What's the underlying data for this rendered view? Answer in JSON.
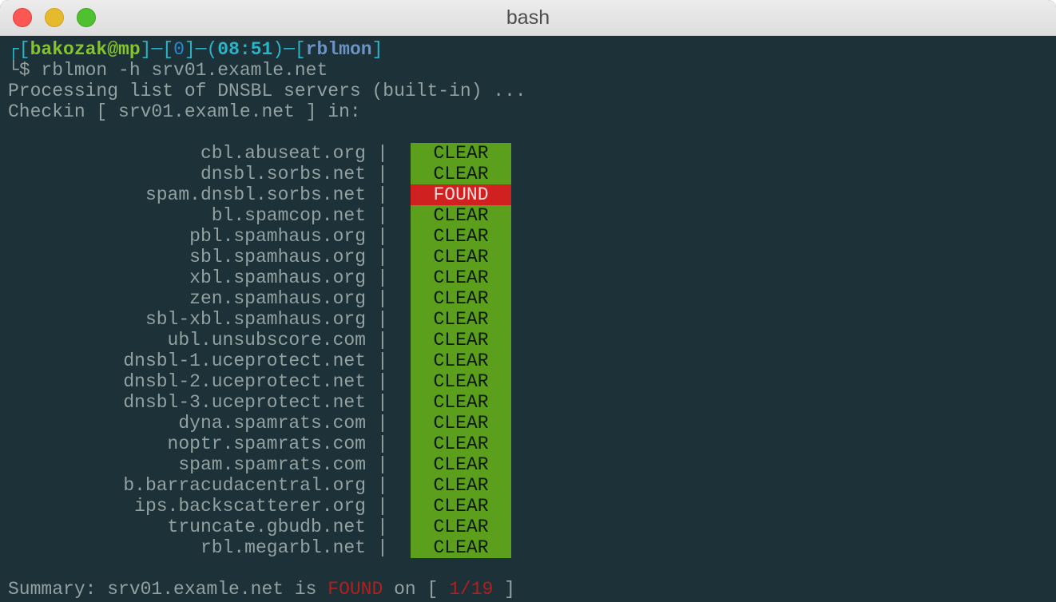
{
  "window": {
    "title": "bash"
  },
  "prompt": {
    "open": "┌[",
    "user": "bakozak@mp",
    "sep1": "]─[",
    "num": "0",
    "sep2": "]─(",
    "time": "08:51",
    "sep3": ")─[",
    "host": "rblmon",
    "close": "]",
    "corner": "└",
    "command": "$ rblmon -h srv01.examle.net"
  },
  "output": {
    "processing": "Processing list of DNSBL servers (built-in) ...",
    "checking": "Checkin [ srv01.examle.net ] in:"
  },
  "separator": "|",
  "servers": [
    {
      "name": "cbl.abuseat.org",
      "status": "CLEAR"
    },
    {
      "name": "dnsbl.sorbs.net",
      "status": "CLEAR"
    },
    {
      "name": "spam.dnsbl.sorbs.net",
      "status": "FOUND"
    },
    {
      "name": "bl.spamcop.net",
      "status": "CLEAR"
    },
    {
      "name": "pbl.spamhaus.org",
      "status": "CLEAR"
    },
    {
      "name": "sbl.spamhaus.org",
      "status": "CLEAR"
    },
    {
      "name": "xbl.spamhaus.org",
      "status": "CLEAR"
    },
    {
      "name": "zen.spamhaus.org",
      "status": "CLEAR"
    },
    {
      "name": "sbl-xbl.spamhaus.org",
      "status": "CLEAR"
    },
    {
      "name": "ubl.unsubscore.com",
      "status": "CLEAR"
    },
    {
      "name": "dnsbl-1.uceprotect.net",
      "status": "CLEAR"
    },
    {
      "name": "dnsbl-2.uceprotect.net",
      "status": "CLEAR"
    },
    {
      "name": "dnsbl-3.uceprotect.net",
      "status": "CLEAR"
    },
    {
      "name": "dyna.spamrats.com",
      "status": "CLEAR"
    },
    {
      "name": "noptr.spamrats.com",
      "status": "CLEAR"
    },
    {
      "name": "spam.spamrats.com",
      "status": "CLEAR"
    },
    {
      "name": "b.barracudacentral.org",
      "status": "CLEAR"
    },
    {
      "name": "ips.backscatterer.org",
      "status": "CLEAR"
    },
    {
      "name": "truncate.gbudb.net",
      "status": "CLEAR"
    },
    {
      "name": "rbl.megarbl.net",
      "status": "CLEAR"
    }
  ],
  "summary": {
    "prefix": "Summary: srv01.examle.net is ",
    "result": "FOUND",
    "middle": " on [ ",
    "count": "1/19",
    "suffix": " ]"
  },
  "colors": {
    "background": "#1c3138",
    "text": "#93a1a1",
    "clear": "#5b9f1c",
    "found": "#d0201f",
    "prompt_user": "#85c52a",
    "prompt_bracket": "#2bb3c7"
  }
}
